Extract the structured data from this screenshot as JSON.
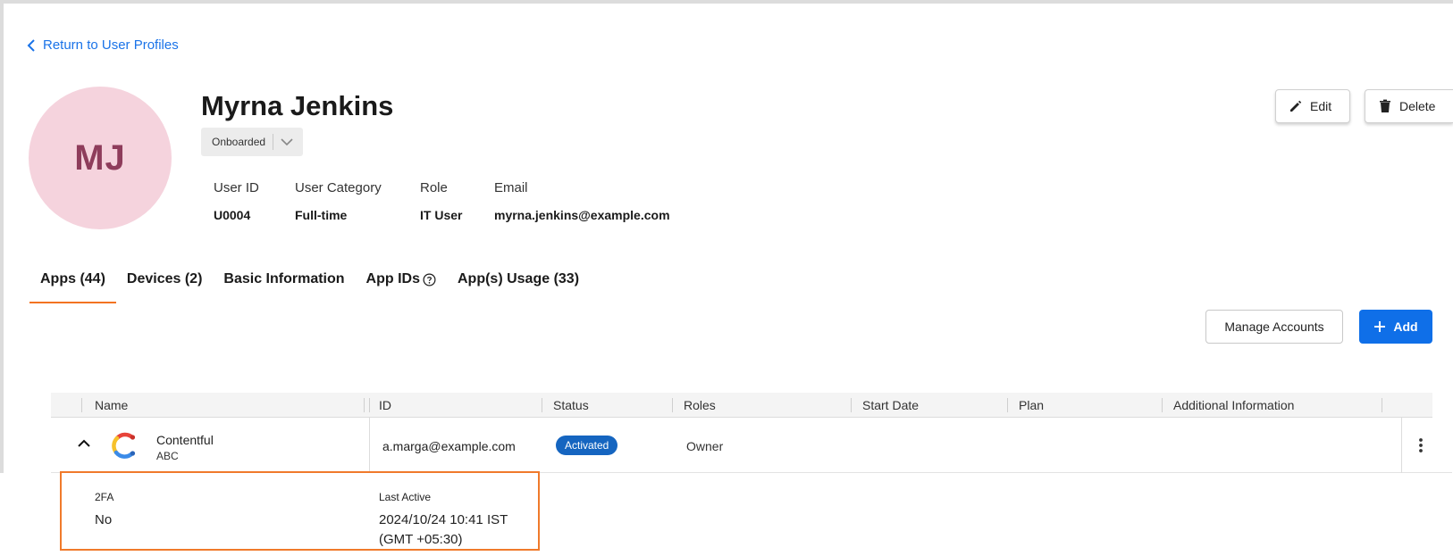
{
  "nav": {
    "back_label": "Return to User Profiles"
  },
  "profile": {
    "initials": "MJ",
    "name": "Myrna Jenkins",
    "status_value": "Onboarded",
    "fields": [
      {
        "key": "User ID",
        "value": "U0004"
      },
      {
        "key": "User Category",
        "value": "Full-time"
      },
      {
        "key": "Role",
        "value": "IT User"
      },
      {
        "key": "Email",
        "value": "myrna.jenkins@example.com"
      }
    ]
  },
  "actions": {
    "edit_label": "Edit",
    "delete_label": "Delete"
  },
  "tabs": [
    {
      "label": "Apps (44)",
      "active": true
    },
    {
      "label": "Devices (2)",
      "active": false
    },
    {
      "label": "Basic Information",
      "active": false
    },
    {
      "label": "App IDs",
      "active": false
    },
    {
      "label": "App(s) Usage (33)",
      "active": false
    }
  ],
  "toolbar": {
    "manage_label": "Manage Accounts",
    "add_label": "Add"
  },
  "table": {
    "columns": [
      "Name",
      "ID",
      "Status",
      "Roles",
      "Start Date",
      "Plan",
      "Additional Information"
    ],
    "rows": [
      {
        "name": "Contentful",
        "sub": "ABC",
        "id": "a.marga@example.com",
        "status": "Activated",
        "roles": "Owner",
        "start_date": "",
        "plan": "",
        "additional": ""
      }
    ],
    "expanded": {
      "twofa_label": "2FA",
      "twofa_value": "No",
      "last_active_label": "Last Active",
      "last_active_line1": "2024/10/24 10:41 IST",
      "last_active_line2": "(GMT +05:30)"
    }
  },
  "colors": {
    "accent": "#f37321",
    "primary": "#0f6fe8",
    "badge": "#1565c0",
    "avatar_bg": "#f5d3dd",
    "avatar_text": "#8e3c5b"
  },
  "icons": {
    "back": "chevron-left-icon",
    "edit": "pencil-icon",
    "delete": "trash-icon",
    "help": "question-circle-icon",
    "add": "plus-icon",
    "collapse": "chevron-up-icon",
    "more": "kebab-icon",
    "app_logo": "contentful-logo-icon"
  }
}
